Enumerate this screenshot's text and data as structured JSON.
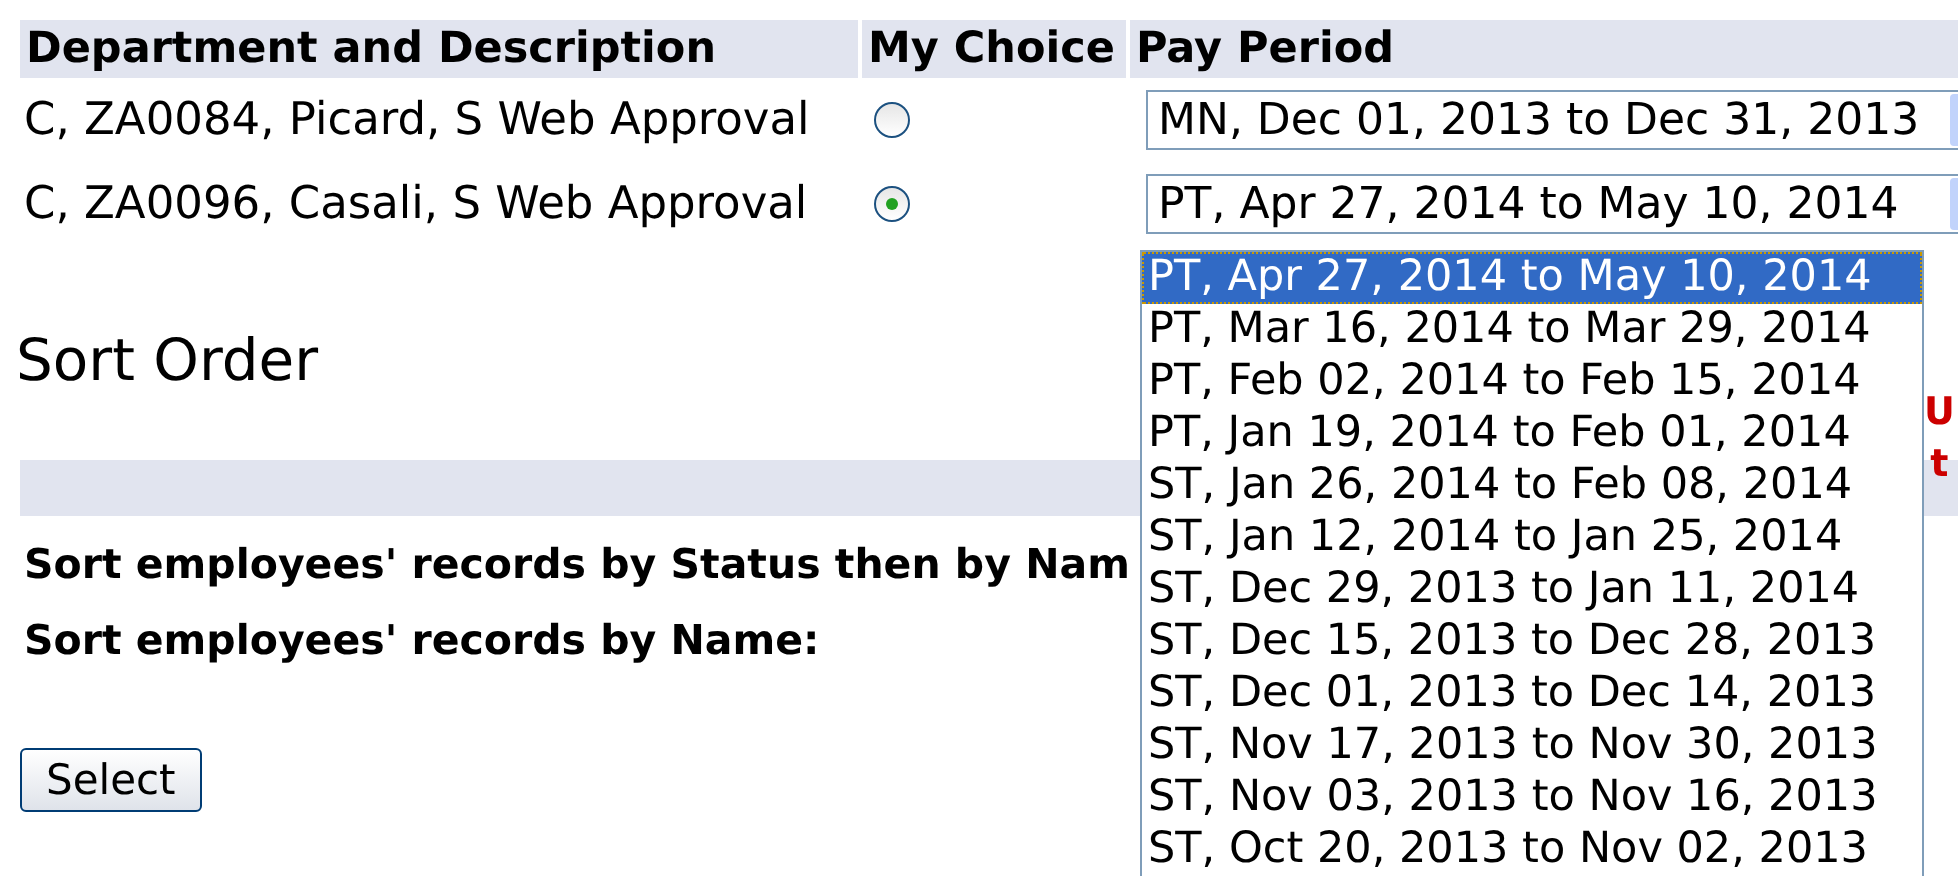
{
  "table": {
    "columns": [
      "Department and Description",
      "My Choice",
      "Pay Period"
    ],
    "rows": [
      {
        "department": "C, ZA0084, Picard, S Web Approval",
        "selected": false,
        "pay_period": "MN, Dec 01, 2013 to Dec 31, 2013"
      },
      {
        "department": "C, ZA0096, Casali, S Web Approval",
        "selected": true,
        "pay_period": "PT, Apr 27, 2014 to May 10, 2014"
      }
    ]
  },
  "dropdown_options": [
    {
      "label": "PT, Apr 27, 2014 to May 10, 2014",
      "selected": true
    },
    {
      "label": "PT, Mar 16, 2014 to Mar 29, 2014",
      "selected": false
    },
    {
      "label": "PT, Feb 02, 2014 to Feb 15, 2014",
      "selected": false
    },
    {
      "label": "PT, Jan 19, 2014 to Feb 01, 2014",
      "selected": false
    },
    {
      "label": "ST, Jan 26, 2014 to Feb 08, 2014",
      "selected": false
    },
    {
      "label": "ST, Jan 12, 2014 to Jan 25, 2014",
      "selected": false
    },
    {
      "label": "ST, Dec 29, 2013 to Jan 11, 2014",
      "selected": false
    },
    {
      "label": "ST, Dec 15, 2013 to Dec 28, 2013",
      "selected": false
    },
    {
      "label": "ST, Dec 01, 2013 to Dec 14, 2013",
      "selected": false
    },
    {
      "label": "ST, Nov 17, 2013 to Nov 30, 2013",
      "selected": false
    },
    {
      "label": "ST, Nov 03, 2013 to Nov 16, 2013",
      "selected": false
    },
    {
      "label": "ST, Oct 20, 2013 to Nov 02, 2013",
      "selected": false
    }
  ],
  "side_note": [
    "U",
    "t"
  ],
  "sort_order": {
    "title": "Sort Order",
    "options": [
      "Sort employees' records by Status then by Nam",
      "Sort employees' records by Name:"
    ],
    "button": "Select"
  }
}
